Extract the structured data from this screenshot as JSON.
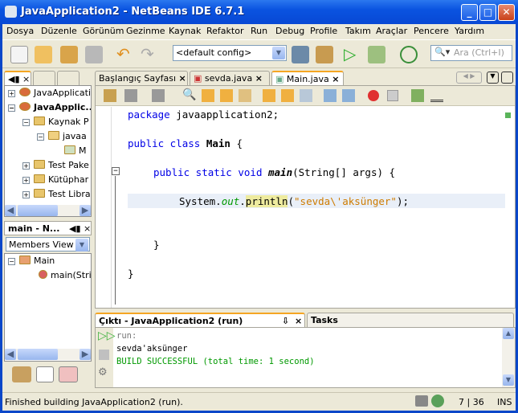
{
  "window": {
    "title": "JavaApplication2 - NetBeans IDE 6.7.1",
    "min": "_",
    "max": "□",
    "close": "✕"
  },
  "menu": [
    "Dosya",
    "Düzenle",
    "Görünüm",
    "Gezinme",
    "Kaynak",
    "Refaktor",
    "Run",
    "Debug",
    "Profile",
    "Takım",
    "Araçlar",
    "Pencere",
    "Yardım"
  ],
  "toolbar": {
    "config": "<default config>",
    "search_placeholder": "Ara (Ctrl+I)"
  },
  "projects": {
    "tabs": [
      "◀▮",
      "×"
    ],
    "tree": [
      "JavaApplicati",
      "JavaApplic...",
      "Kaynak P",
      "javaa",
      "M",
      "Test Pake",
      "Kütüphar",
      "Test Libra"
    ]
  },
  "navigator": {
    "title": "main - N...",
    "view": "Members View",
    "tree": [
      "Main",
      "main(Stri"
    ]
  },
  "editor": {
    "tabs": [
      "Başlangıç Sayfası",
      "sevda.java",
      "Main.java"
    ],
    "code": {
      "package_kw": "package",
      "package_name": " javaapplication2;",
      "public1": "public",
      "class": " class ",
      "main_class": "Main",
      "brace": " {",
      "public2": "public",
      "static": " static",
      "void": " void ",
      "main": "main",
      "sig": "(String[] args) {",
      "system": "System.",
      "out": "out",
      "dot": ".",
      "println": "println",
      "paren": "(",
      "string": "\"sevda\\'aksünger\"",
      "end": ");",
      "close1": "}",
      "close2": "}"
    }
  },
  "output": {
    "tab": "Çıktı - JavaApplication2 (run)",
    "tasks_tab": "Tasks",
    "lines": [
      "run:",
      "sevda'aksünger",
      "BUILD SUCCESSFUL (total time: 1 second)"
    ]
  },
  "status": {
    "message": "Finished building JavaApplication2 (run).",
    "position": "7 | 36",
    "mode": "INS"
  },
  "colors": {
    "keyword": "#0000e6",
    "string": "#ce7b00",
    "success": "#009900",
    "accent": "#f5a623"
  }
}
